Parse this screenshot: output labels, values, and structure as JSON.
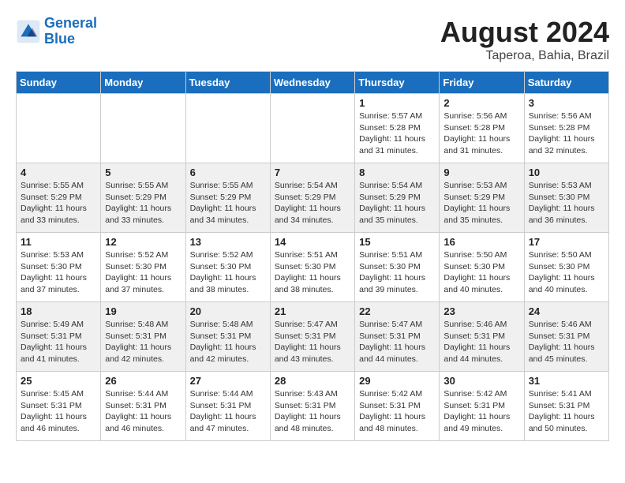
{
  "logo": {
    "line1": "General",
    "line2": "Blue"
  },
  "title": "August 2024",
  "location": "Taperoa, Bahia, Brazil",
  "days_of_week": [
    "Sunday",
    "Monday",
    "Tuesday",
    "Wednesday",
    "Thursday",
    "Friday",
    "Saturday"
  ],
  "weeks": [
    [
      {
        "day": "",
        "sunrise": "",
        "sunset": "",
        "daylight": ""
      },
      {
        "day": "",
        "sunrise": "",
        "sunset": "",
        "daylight": ""
      },
      {
        "day": "",
        "sunrise": "",
        "sunset": "",
        "daylight": ""
      },
      {
        "day": "",
        "sunrise": "",
        "sunset": "",
        "daylight": ""
      },
      {
        "day": "1",
        "sunrise": "Sunrise: 5:57 AM",
        "sunset": "Sunset: 5:28 PM",
        "daylight": "Daylight: 11 hours and 31 minutes."
      },
      {
        "day": "2",
        "sunrise": "Sunrise: 5:56 AM",
        "sunset": "Sunset: 5:28 PM",
        "daylight": "Daylight: 11 hours and 31 minutes."
      },
      {
        "day": "3",
        "sunrise": "Sunrise: 5:56 AM",
        "sunset": "Sunset: 5:28 PM",
        "daylight": "Daylight: 11 hours and 32 minutes."
      }
    ],
    [
      {
        "day": "4",
        "sunrise": "Sunrise: 5:55 AM",
        "sunset": "Sunset: 5:29 PM",
        "daylight": "Daylight: 11 hours and 33 minutes."
      },
      {
        "day": "5",
        "sunrise": "Sunrise: 5:55 AM",
        "sunset": "Sunset: 5:29 PM",
        "daylight": "Daylight: 11 hours and 33 minutes."
      },
      {
        "day": "6",
        "sunrise": "Sunrise: 5:55 AM",
        "sunset": "Sunset: 5:29 PM",
        "daylight": "Daylight: 11 hours and 34 minutes."
      },
      {
        "day": "7",
        "sunrise": "Sunrise: 5:54 AM",
        "sunset": "Sunset: 5:29 PM",
        "daylight": "Daylight: 11 hours and 34 minutes."
      },
      {
        "day": "8",
        "sunrise": "Sunrise: 5:54 AM",
        "sunset": "Sunset: 5:29 PM",
        "daylight": "Daylight: 11 hours and 35 minutes."
      },
      {
        "day": "9",
        "sunrise": "Sunrise: 5:53 AM",
        "sunset": "Sunset: 5:29 PM",
        "daylight": "Daylight: 11 hours and 35 minutes."
      },
      {
        "day": "10",
        "sunrise": "Sunrise: 5:53 AM",
        "sunset": "Sunset: 5:30 PM",
        "daylight": "Daylight: 11 hours and 36 minutes."
      }
    ],
    [
      {
        "day": "11",
        "sunrise": "Sunrise: 5:53 AM",
        "sunset": "Sunset: 5:30 PM",
        "daylight": "Daylight: 11 hours and 37 minutes."
      },
      {
        "day": "12",
        "sunrise": "Sunrise: 5:52 AM",
        "sunset": "Sunset: 5:30 PM",
        "daylight": "Daylight: 11 hours and 37 minutes."
      },
      {
        "day": "13",
        "sunrise": "Sunrise: 5:52 AM",
        "sunset": "Sunset: 5:30 PM",
        "daylight": "Daylight: 11 hours and 38 minutes."
      },
      {
        "day": "14",
        "sunrise": "Sunrise: 5:51 AM",
        "sunset": "Sunset: 5:30 PM",
        "daylight": "Daylight: 11 hours and 38 minutes."
      },
      {
        "day": "15",
        "sunrise": "Sunrise: 5:51 AM",
        "sunset": "Sunset: 5:30 PM",
        "daylight": "Daylight: 11 hours and 39 minutes."
      },
      {
        "day": "16",
        "sunrise": "Sunrise: 5:50 AM",
        "sunset": "Sunset: 5:30 PM",
        "daylight": "Daylight: 11 hours and 40 minutes."
      },
      {
        "day": "17",
        "sunrise": "Sunrise: 5:50 AM",
        "sunset": "Sunset: 5:30 PM",
        "daylight": "Daylight: 11 hours and 40 minutes."
      }
    ],
    [
      {
        "day": "18",
        "sunrise": "Sunrise: 5:49 AM",
        "sunset": "Sunset: 5:31 PM",
        "daylight": "Daylight: 11 hours and 41 minutes."
      },
      {
        "day": "19",
        "sunrise": "Sunrise: 5:48 AM",
        "sunset": "Sunset: 5:31 PM",
        "daylight": "Daylight: 11 hours and 42 minutes."
      },
      {
        "day": "20",
        "sunrise": "Sunrise: 5:48 AM",
        "sunset": "Sunset: 5:31 PM",
        "daylight": "Daylight: 11 hours and 42 minutes."
      },
      {
        "day": "21",
        "sunrise": "Sunrise: 5:47 AM",
        "sunset": "Sunset: 5:31 PM",
        "daylight": "Daylight: 11 hours and 43 minutes."
      },
      {
        "day": "22",
        "sunrise": "Sunrise: 5:47 AM",
        "sunset": "Sunset: 5:31 PM",
        "daylight": "Daylight: 11 hours and 44 minutes."
      },
      {
        "day": "23",
        "sunrise": "Sunrise: 5:46 AM",
        "sunset": "Sunset: 5:31 PM",
        "daylight": "Daylight: 11 hours and 44 minutes."
      },
      {
        "day": "24",
        "sunrise": "Sunrise: 5:46 AM",
        "sunset": "Sunset: 5:31 PM",
        "daylight": "Daylight: 11 hours and 45 minutes."
      }
    ],
    [
      {
        "day": "25",
        "sunrise": "Sunrise: 5:45 AM",
        "sunset": "Sunset: 5:31 PM",
        "daylight": "Daylight: 11 hours and 46 minutes."
      },
      {
        "day": "26",
        "sunrise": "Sunrise: 5:44 AM",
        "sunset": "Sunset: 5:31 PM",
        "daylight": "Daylight: 11 hours and 46 minutes."
      },
      {
        "day": "27",
        "sunrise": "Sunrise: 5:44 AM",
        "sunset": "Sunset: 5:31 PM",
        "daylight": "Daylight: 11 hours and 47 minutes."
      },
      {
        "day": "28",
        "sunrise": "Sunrise: 5:43 AM",
        "sunset": "Sunset: 5:31 PM",
        "daylight": "Daylight: 11 hours and 48 minutes."
      },
      {
        "day": "29",
        "sunrise": "Sunrise: 5:42 AM",
        "sunset": "Sunset: 5:31 PM",
        "daylight": "Daylight: 11 hours and 48 minutes."
      },
      {
        "day": "30",
        "sunrise": "Sunrise: 5:42 AM",
        "sunset": "Sunset: 5:31 PM",
        "daylight": "Daylight: 11 hours and 49 minutes."
      },
      {
        "day": "31",
        "sunrise": "Sunrise: 5:41 AM",
        "sunset": "Sunset: 5:31 PM",
        "daylight": "Daylight: 11 hours and 50 minutes."
      }
    ]
  ]
}
